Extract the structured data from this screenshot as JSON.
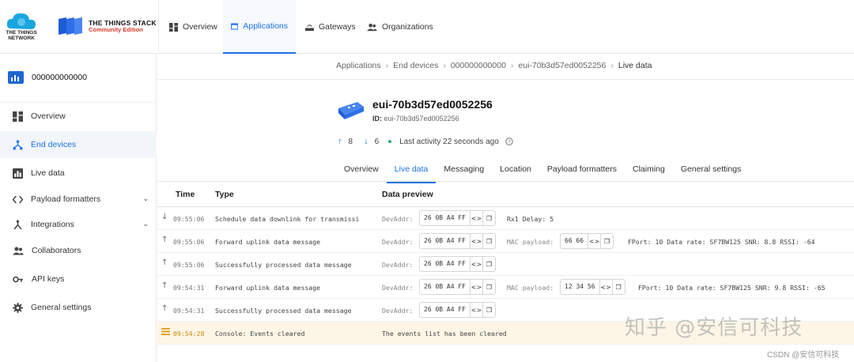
{
  "brand": {
    "tti_line1": "THE THINGS",
    "tti_line2": "NETWORK",
    "stack_title": "THE THINGS STACK",
    "stack_subtitle": "Community Edition"
  },
  "topnav": [
    {
      "label": "Overview",
      "icon": "dashboard-icon",
      "active": false
    },
    {
      "label": "Applications",
      "icon": "window-icon",
      "active": true
    },
    {
      "label": "Gateways",
      "icon": "gateway-icon",
      "active": false
    },
    {
      "label": "Organizations",
      "icon": "people-icon",
      "active": false
    }
  ],
  "sidebar": {
    "app_name": "000000000000",
    "items": [
      {
        "label": "Overview",
        "icon": "dashboard-icon",
        "active": false
      },
      {
        "label": "End devices",
        "icon": "device-tree-icon",
        "active": true
      },
      {
        "label": "Live data",
        "icon": "chart-icon",
        "active": false
      },
      {
        "label": "Payload formatters",
        "icon": "code-icon",
        "active": false,
        "chevron": "⌄"
      },
      {
        "label": "Integrations",
        "icon": "integration-icon",
        "active": false,
        "chevron": "⌄"
      },
      {
        "label": "Collaborators",
        "icon": "people-icon",
        "active": false
      },
      {
        "label": "API keys",
        "icon": "key-icon",
        "active": false
      },
      {
        "label": "General settings",
        "icon": "gear-icon",
        "active": false
      }
    ]
  },
  "breadcrumb": [
    "Applications",
    "End devices",
    "000000000000",
    "eui-70b3d57ed0052256",
    "Live data"
  ],
  "device": {
    "title": "eui-70b3d57ed0052256",
    "id_label": "ID:",
    "id_value": "eui-70b3d57ed0052256",
    "uplink_count": "8",
    "downlink_count": "6",
    "last_activity": "Last activity 22 seconds ago"
  },
  "tabs": [
    "Overview",
    "Live data",
    "Messaging",
    "Location",
    "Payload formatters",
    "Claiming",
    "General settings"
  ],
  "active_tab": "Live data",
  "table": {
    "headers": {
      "time": "Time",
      "type": "Type",
      "preview": "Data preview"
    },
    "rows": [
      {
        "dir": "↓",
        "time": "09:55:06",
        "type": "Schedule data downlink for transmissi",
        "devaddr_label": "DevAddr:",
        "devaddr": "26 0B A4 FF",
        "extra": "Rx1 Delay: 5"
      },
      {
        "dir": "↑",
        "time": "09:55:06",
        "type": "Forward uplink data message",
        "devaddr_label": "DevAddr:",
        "devaddr": "26 0B A4 FF",
        "mac_label": "MAC payload:",
        "mac": "66 66",
        "extra": "FPort: 10  Data rate: SF7BW125  SNR: 8.8  RSSI: -64"
      },
      {
        "dir": "↑",
        "time": "09:55:06",
        "type": "Successfully processed data message",
        "devaddr_label": "DevAddr:",
        "devaddr": "26 0B A4 FF"
      },
      {
        "dir": "↑",
        "time": "09:54:31",
        "type": "Forward uplink data message",
        "devaddr_label": "DevAddr:",
        "devaddr": "26 0B A4 FF",
        "mac_label": "MAC payload:",
        "mac": "12 34 56",
        "extra": "FPort: 10  Data rate: SF7BW125  SNR: 9.8  RSSI: -65"
      },
      {
        "dir": "↑",
        "time": "09:54:31",
        "type": "Successfully processed data message",
        "devaddr_label": "DevAddr:",
        "devaddr": "26 0B A4 FF"
      },
      {
        "dir": "≡",
        "time": "09:54:28",
        "type": "Console: Events cleared",
        "note": "The events list has been cleared"
      }
    ]
  },
  "watermark": "知乎 @安信可科技",
  "csdn_mark": "CSDN @安信可科技",
  "colors": {
    "accent": "#1a73e8",
    "brand_red": "#d63b2f",
    "info_row": "#fdf6e6"
  }
}
